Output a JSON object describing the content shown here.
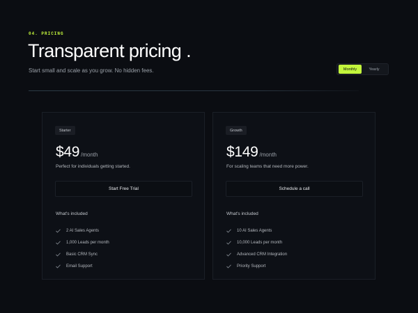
{
  "header": {
    "eyebrow": "04. PRICING",
    "title": "Transparent pricing .",
    "subtitle": "Start small and scale as you grow. No hidden fees."
  },
  "billing_toggle": {
    "options": [
      "Monthly",
      "Yearly"
    ],
    "selected": "Monthly"
  },
  "colors": {
    "accent": "#c3f53c",
    "background": "#0b0d12"
  },
  "plans": [
    {
      "badge": "Starter",
      "price": "$49",
      "period": "/month",
      "description": "Perfect for individuals getting started.",
      "cta": "Start Free Trial",
      "included_label": "What's included",
      "features": [
        "2 AI Sales Agents",
        "1,000 Leads per month",
        "Basic CRM Sync",
        "Email Support"
      ],
      "feature_icon": "check-icon"
    },
    {
      "badge": "Growth",
      "price": "$149",
      "period": "/month",
      "description": "For scaling teams that need more power.",
      "cta": "Schedule a call",
      "included_label": "What's included",
      "features": [
        "10 AI Sales Agents",
        "10,000 Leads per month",
        "Advanced CRM Integration",
        "Priority Support"
      ],
      "feature_icon": "check-icon"
    }
  ]
}
